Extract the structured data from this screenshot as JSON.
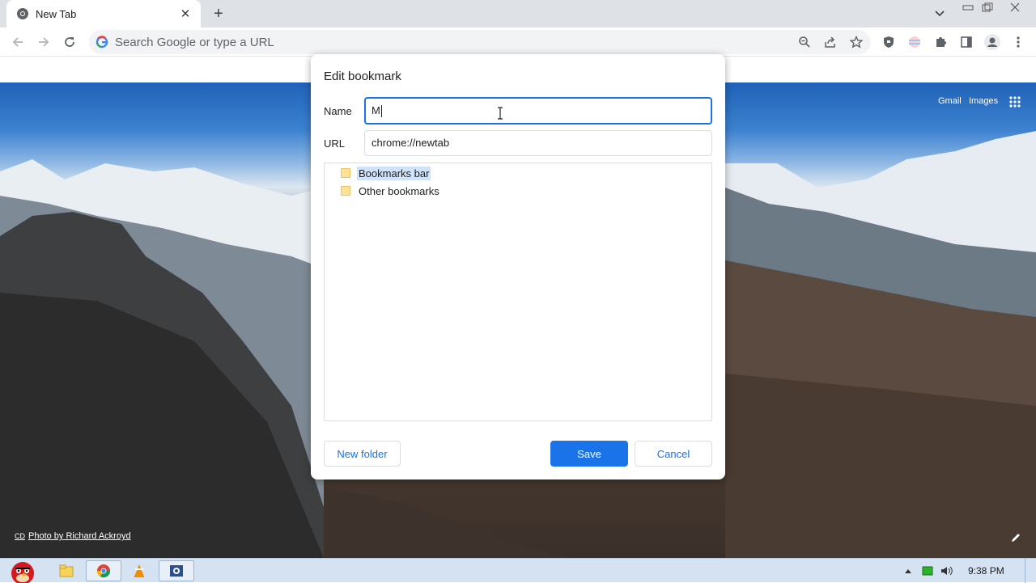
{
  "browser": {
    "tab": {
      "title": "New Tab"
    },
    "omnibox": {
      "placeholder": "Search Google or type a URL"
    }
  },
  "ntp": {
    "links": {
      "gmail": "Gmail",
      "images": "Images"
    },
    "credit": "Photo by Richard Ackroyd",
    "credit_prefix": "CD"
  },
  "dialog": {
    "title": "Edit bookmark",
    "name_label": "Name",
    "name_value": "M",
    "url_label": "URL",
    "url_value": "chrome://newtab",
    "folders": [
      {
        "label": "Bookmarks bar",
        "selected": true
      },
      {
        "label": "Other bookmarks",
        "selected": false
      }
    ],
    "buttons": {
      "new_folder": "New folder",
      "save": "Save",
      "cancel": "Cancel"
    }
  },
  "taskbar": {
    "time": "9:38 PM"
  },
  "colors": {
    "accent": "#1a73e8",
    "selection": "#cfe3fb",
    "folder": "#fde293"
  }
}
